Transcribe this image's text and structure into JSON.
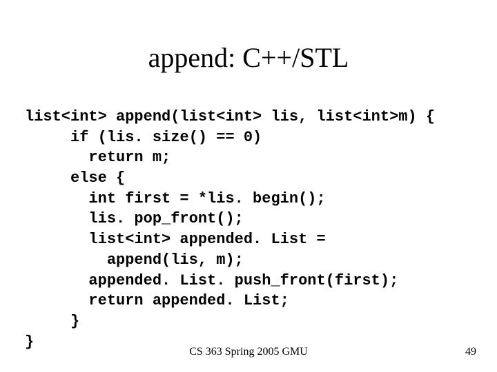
{
  "title": "append: C++/STL",
  "code": {
    "l1": "list<int> append(list<int> lis, list<int>m) {",
    "l2": "     if (lis. size() == 0)",
    "l3": "       return m;",
    "l4": "     else {",
    "l5": "       int first = *lis. begin();",
    "l6": "       lis. pop_front();",
    "l7": "       list<int> appended. List =",
    "l8": "         append(lis, m);",
    "l9": "       appended. List. push_front(first);",
    "l10": "       return appended. List;",
    "l11": "     }",
    "l12": "}"
  },
  "footer": {
    "course": "CS 363 Spring 2005 GMU",
    "page": "49"
  }
}
